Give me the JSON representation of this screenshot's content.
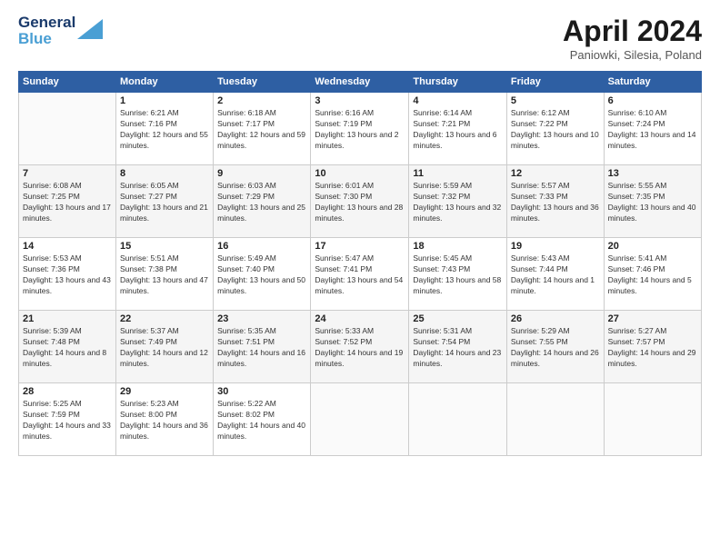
{
  "header": {
    "logo_line1": "General",
    "logo_line2": "Blue",
    "month_title": "April 2024",
    "location": "Paniowki, Silesia, Poland"
  },
  "weekdays": [
    "Sunday",
    "Monday",
    "Tuesday",
    "Wednesday",
    "Thursday",
    "Friday",
    "Saturday"
  ],
  "weeks": [
    [
      {
        "day": "",
        "sunrise": "",
        "sunset": "",
        "daylight": ""
      },
      {
        "day": "1",
        "sunrise": "Sunrise: 6:21 AM",
        "sunset": "Sunset: 7:16 PM",
        "daylight": "Daylight: 12 hours and 55 minutes."
      },
      {
        "day": "2",
        "sunrise": "Sunrise: 6:18 AM",
        "sunset": "Sunset: 7:17 PM",
        "daylight": "Daylight: 12 hours and 59 minutes."
      },
      {
        "day": "3",
        "sunrise": "Sunrise: 6:16 AM",
        "sunset": "Sunset: 7:19 PM",
        "daylight": "Daylight: 13 hours and 2 minutes."
      },
      {
        "day": "4",
        "sunrise": "Sunrise: 6:14 AM",
        "sunset": "Sunset: 7:21 PM",
        "daylight": "Daylight: 13 hours and 6 minutes."
      },
      {
        "day": "5",
        "sunrise": "Sunrise: 6:12 AM",
        "sunset": "Sunset: 7:22 PM",
        "daylight": "Daylight: 13 hours and 10 minutes."
      },
      {
        "day": "6",
        "sunrise": "Sunrise: 6:10 AM",
        "sunset": "Sunset: 7:24 PM",
        "daylight": "Daylight: 13 hours and 14 minutes."
      }
    ],
    [
      {
        "day": "7",
        "sunrise": "Sunrise: 6:08 AM",
        "sunset": "Sunset: 7:25 PM",
        "daylight": "Daylight: 13 hours and 17 minutes."
      },
      {
        "day": "8",
        "sunrise": "Sunrise: 6:05 AM",
        "sunset": "Sunset: 7:27 PM",
        "daylight": "Daylight: 13 hours and 21 minutes."
      },
      {
        "day": "9",
        "sunrise": "Sunrise: 6:03 AM",
        "sunset": "Sunset: 7:29 PM",
        "daylight": "Daylight: 13 hours and 25 minutes."
      },
      {
        "day": "10",
        "sunrise": "Sunrise: 6:01 AM",
        "sunset": "Sunset: 7:30 PM",
        "daylight": "Daylight: 13 hours and 28 minutes."
      },
      {
        "day": "11",
        "sunrise": "Sunrise: 5:59 AM",
        "sunset": "Sunset: 7:32 PM",
        "daylight": "Daylight: 13 hours and 32 minutes."
      },
      {
        "day": "12",
        "sunrise": "Sunrise: 5:57 AM",
        "sunset": "Sunset: 7:33 PM",
        "daylight": "Daylight: 13 hours and 36 minutes."
      },
      {
        "day": "13",
        "sunrise": "Sunrise: 5:55 AM",
        "sunset": "Sunset: 7:35 PM",
        "daylight": "Daylight: 13 hours and 40 minutes."
      }
    ],
    [
      {
        "day": "14",
        "sunrise": "Sunrise: 5:53 AM",
        "sunset": "Sunset: 7:36 PM",
        "daylight": "Daylight: 13 hours and 43 minutes."
      },
      {
        "day": "15",
        "sunrise": "Sunrise: 5:51 AM",
        "sunset": "Sunset: 7:38 PM",
        "daylight": "Daylight: 13 hours and 47 minutes."
      },
      {
        "day": "16",
        "sunrise": "Sunrise: 5:49 AM",
        "sunset": "Sunset: 7:40 PM",
        "daylight": "Daylight: 13 hours and 50 minutes."
      },
      {
        "day": "17",
        "sunrise": "Sunrise: 5:47 AM",
        "sunset": "Sunset: 7:41 PM",
        "daylight": "Daylight: 13 hours and 54 minutes."
      },
      {
        "day": "18",
        "sunrise": "Sunrise: 5:45 AM",
        "sunset": "Sunset: 7:43 PM",
        "daylight": "Daylight: 13 hours and 58 minutes."
      },
      {
        "day": "19",
        "sunrise": "Sunrise: 5:43 AM",
        "sunset": "Sunset: 7:44 PM",
        "daylight": "Daylight: 14 hours and 1 minute."
      },
      {
        "day": "20",
        "sunrise": "Sunrise: 5:41 AM",
        "sunset": "Sunset: 7:46 PM",
        "daylight": "Daylight: 14 hours and 5 minutes."
      }
    ],
    [
      {
        "day": "21",
        "sunrise": "Sunrise: 5:39 AM",
        "sunset": "Sunset: 7:48 PM",
        "daylight": "Daylight: 14 hours and 8 minutes."
      },
      {
        "day": "22",
        "sunrise": "Sunrise: 5:37 AM",
        "sunset": "Sunset: 7:49 PM",
        "daylight": "Daylight: 14 hours and 12 minutes."
      },
      {
        "day": "23",
        "sunrise": "Sunrise: 5:35 AM",
        "sunset": "Sunset: 7:51 PM",
        "daylight": "Daylight: 14 hours and 16 minutes."
      },
      {
        "day": "24",
        "sunrise": "Sunrise: 5:33 AM",
        "sunset": "Sunset: 7:52 PM",
        "daylight": "Daylight: 14 hours and 19 minutes."
      },
      {
        "day": "25",
        "sunrise": "Sunrise: 5:31 AM",
        "sunset": "Sunset: 7:54 PM",
        "daylight": "Daylight: 14 hours and 23 minutes."
      },
      {
        "day": "26",
        "sunrise": "Sunrise: 5:29 AM",
        "sunset": "Sunset: 7:55 PM",
        "daylight": "Daylight: 14 hours and 26 minutes."
      },
      {
        "day": "27",
        "sunrise": "Sunrise: 5:27 AM",
        "sunset": "Sunset: 7:57 PM",
        "daylight": "Daylight: 14 hours and 29 minutes."
      }
    ],
    [
      {
        "day": "28",
        "sunrise": "Sunrise: 5:25 AM",
        "sunset": "Sunset: 7:59 PM",
        "daylight": "Daylight: 14 hours and 33 minutes."
      },
      {
        "day": "29",
        "sunrise": "Sunrise: 5:23 AM",
        "sunset": "Sunset: 8:00 PM",
        "daylight": "Daylight: 14 hours and 36 minutes."
      },
      {
        "day": "30",
        "sunrise": "Sunrise: 5:22 AM",
        "sunset": "Sunset: 8:02 PM",
        "daylight": "Daylight: 14 hours and 40 minutes."
      },
      {
        "day": "",
        "sunrise": "",
        "sunset": "",
        "daylight": ""
      },
      {
        "day": "",
        "sunrise": "",
        "sunset": "",
        "daylight": ""
      },
      {
        "day": "",
        "sunrise": "",
        "sunset": "",
        "daylight": ""
      },
      {
        "day": "",
        "sunrise": "",
        "sunset": "",
        "daylight": ""
      }
    ]
  ]
}
